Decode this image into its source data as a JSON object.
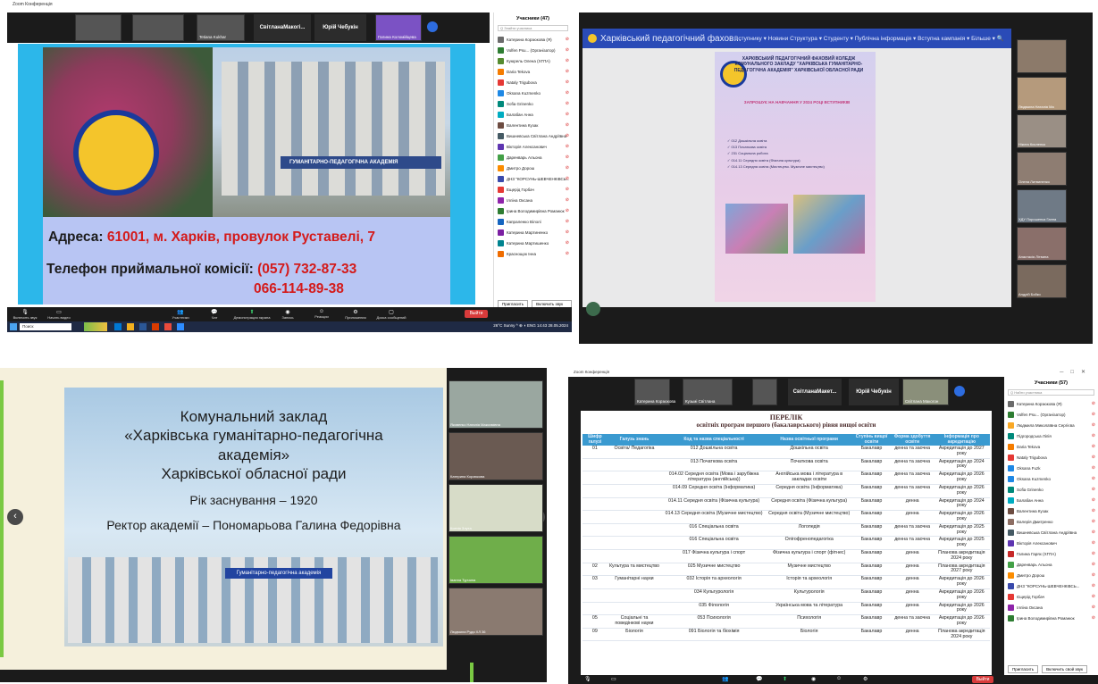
{
  "q1": {
    "app_title": "Zoom Конференція",
    "thumbnails": [
      {
        "name": ""
      },
      {
        "name": ""
      },
      {
        "name": "Tetiana Kukhar"
      },
      {
        "name": "Віктор Олександрович"
      }
    ],
    "name_tiles": [
      "СвітланаМакогі...",
      "Юрій Чебукін"
    ],
    "host_name": "Галина Коломійцева",
    "slide": {
      "sign": "ГУМАНІТАРНО-ПЕДАГОГІЧНА АКАДЕМІЯ",
      "address_label": "Адреса: ",
      "address_value": "61001, м. Харків, провулок Руставелі, 7",
      "phone_label": "Телефон приймальної комісії: ",
      "phone_value": "(057) 732-87-33",
      "phone_value2": "066-114-89-38"
    },
    "panel": {
      "title": "Учасники (47)",
      "search_placeholder": "Q Знайти учасника",
      "items": [
        {
          "name": "Катерина Корзюкова (Я)",
          "color": "#6b6b6b"
        },
        {
          "name": "Volfen Psu... (Організатор)",
          "color": "#2e7d32"
        },
        {
          "name": "Куюрель Олена (ХГПА)",
          "color": "#558b2f"
        },
        {
          "name": "Daria Tekova",
          "color": "#f57c00"
        },
        {
          "name": "Nataly Trigubova",
          "color": "#e53935"
        },
        {
          "name": "Oksana Kuzmenko",
          "color": "#1e88e5"
        },
        {
          "name": "Sofia Grinenko",
          "color": "#00897b"
        },
        {
          "name": "Балабан Анна",
          "color": "#00acc1"
        },
        {
          "name": "Валентина Кузак",
          "color": "#6d4c41"
        },
        {
          "name": "Вишневська Світлана Андріївна",
          "color": "#455a64"
        },
        {
          "name": "Вікторія Алексанович",
          "color": "#5e35b1"
        },
        {
          "name": "Даренварь Альона",
          "color": "#43a047"
        },
        {
          "name": "Дмитро Дорош",
          "color": "#fb8c00"
        },
        {
          "name": "ДНЗ \"КОРСУНЬ-ШЕВЧЕНКІВСЬ...",
          "color": "#3949ab"
        },
        {
          "name": "Ещерід Горбач",
          "color": "#e53935"
        },
        {
          "name": "Ілліна Оксана",
          "color": "#8e24aa"
        },
        {
          "name": "Ірина Володимирівна Романюк",
          "color": "#2e7d32"
        },
        {
          "name": "Капраленко Вілолі",
          "color": "#1565c0"
        },
        {
          "name": "Катерина Мартиненко",
          "color": "#7b1fa2"
        },
        {
          "name": "Катерина Мартишенко",
          "color": "#00838f"
        },
        {
          "name": "Краснощок Інна",
          "color": "#ef6c00"
        }
      ],
      "invite_button": "Пригласить",
      "mute_all_button": "Включить звук все"
    },
    "toolbar": {
      "items": [
        "Включить звук",
        "Начать видео",
        "Участники",
        "Чат",
        "Демонстрация экрана",
        "Запись",
        "Реакции",
        "Приложения",
        "Доска сообщений"
      ],
      "end_button": "Выйти"
    },
    "taskbar": {
      "search": "Поиск",
      "tray": "26°C Sunny  ^ ⊕ ◖ ENG 14:43 28.05.2024"
    }
  },
  "q2": {
    "site_title": "Харківський педагогічний фахов...",
    "menu": "Вступнику ▾   Новини   Структура ▾   Студенту ▾   Публічна інформація ▾   Вступна кампанія ▾   Більше ▾   🔍",
    "poster_head": "ХАРКІВСЬКИЙ ПЕДАГОГІЧНИЙ ФАХОВИЙ КОЛЕДЖ КОМУНАЛЬНОГО ЗАКЛАДУ \"ХАРКІВСЬКА ГУМАНІТАРНО-ПЕДАГОГІЧНА АКАДЕМІЯ\" ХАРКІВСЬКОЇ ОБЛАСНОЇ РАДИ",
    "poster_invite": "ЗАПРОШУЄ НА НАВЧАННЯ У 2024 РОЦІ ВСТУПНИКІВ",
    "bullets": [
      "012 Дошкільна освіта",
      "013 Початкова освіта",
      "231 Соціальна робота",
      "014.11 Середня освіта (Фізична культура)",
      "014.13 Середня освіта (Мистецтво. Музичне мистецтво)"
    ],
    "participants": [
      "",
      "Людмила Наталія Ма",
      "Нікита Кисленко",
      "Олена Литвиненко",
      "ХДУ Порошенка Ганна",
      "Анастасія Літвина",
      "Андрій Бойко"
    ]
  },
  "q3": {
    "title_lines": [
      "Комунальний заклад",
      "«Харківська гуманітарно-педагогічна",
      "академія»",
      "Харківської обласної ради"
    ],
    "founded": "Рік заснування – 1920",
    "rector": "Ректор академії – Пономарьова Галина Федорівна",
    "sign": "Гуманітарно-педагогічна академія",
    "arrow_prev": "‹",
    "arrow_next": "›",
    "participants": [
      "Яковенко Наталія Максимівна",
      "Катерина Корзюкова",
      "Ксенія Злута",
      "Іванна Турчина",
      "Людмила Рудя ХЛ 36"
    ]
  },
  "q4": {
    "app_title": "Zoom Конференція",
    "thumbnails": [
      "Катерина Корзюкова",
      "Кузьмі Світлана",
      "Світлана Макогон"
    ],
    "name_tiles": [
      "СвітланаМакет...",
      "Юрій Чебукін"
    ],
    "doc_title": "ПЕРЕЛІК",
    "doc_subtitle": "освітніх програм першого (бакалаврського) рівня  вищої освіти",
    "table": {
      "headers": [
        "Шифр галузі",
        "Галузь знань",
        "Код та назва спеціальності",
        "Назва освітньої програми",
        "Ступінь вищої освіти",
        "Форма здобуття освіти",
        "Інформація про акредитацію"
      ],
      "rows": [
        [
          "01",
          "Освіта/ Педагогіка",
          "012 Дошкільна освіта",
          "Дошкільна освіта",
          "Бакалавр",
          "денна та заочна",
          "Акредитація до 2027 року"
        ],
        [
          "",
          "",
          "013 Початкова освіта",
          "Початкова освіта",
          "Бакалавр",
          "денна та заочна",
          "Акредитація до 2024 року"
        ],
        [
          "",
          "",
          "014.02 Середня освіта (Мова і зарубіжна література (англійська))",
          "Англійська мова і література в закладах освіти",
          "Бакалавр",
          "денна та заочна",
          "Акредитація до 2026 року"
        ],
        [
          "",
          "",
          "014.09 Середня освіта (Інформатика)",
          "Середня освіта (Інформатика)",
          "Бакалавр",
          "денна та заочна",
          "Акредитація до 2026 року"
        ],
        [
          "",
          "",
          "014.11 Середня освіта (Фізична культура)",
          "Середня освіта (Фізична культура)",
          "Бакалавр",
          "денна",
          "Акредитація до 2024 року"
        ],
        [
          "",
          "",
          "014.13 Середня освіта (Музичне мистецтво)",
          "Середня освіта (Музичне мистецтво)",
          "Бакалавр",
          "денна",
          "Акредитація до 2026 року"
        ],
        [
          "",
          "",
          "016 Спеціальна освіта",
          "Логопедія",
          "Бакалавр",
          "денна та заочна",
          "Акредитація до 2025 року"
        ],
        [
          "",
          "",
          "016 Спеціальна освіта",
          "Олігофренопедагогіка",
          "Бакалавр",
          "денна та заочна",
          "Акредитація до 2025 року"
        ],
        [
          "",
          "",
          "017 Фізична культура і спорт",
          "Фізична культура і спорт (фітнес)",
          "Бакалавр",
          "денна",
          "Планова акредитація 2024 року"
        ],
        [
          "02",
          "Культура та мистецтво",
          "025 Музичне мистецтво",
          "Музичне мистецтво",
          "Бакалавр",
          "денна",
          "Планова акредитація 2027 року"
        ],
        [
          "03",
          "Гуманітарні науки",
          "032 Історія та археологія",
          "Історія та археологія",
          "Бакалавр",
          "денна",
          "Акредитація до 2026 року"
        ],
        [
          "",
          "",
          "034 Культурологія",
          "Культурологія",
          "Бакалавр",
          "денна",
          "Акредитація до 2026 року"
        ],
        [
          "",
          "",
          "035 Філологія",
          "Українська мова та література",
          "Бакалавр",
          "денна",
          "Акредитація до 2026 року"
        ],
        [
          "05",
          "Соціальні та поведінкові науки",
          "053 Психологія",
          "Психологія",
          "Бакалавр",
          "денна та заочна",
          "Акредитація до 2026 року"
        ],
        [
          "09",
          "Біологія",
          "091 Біологія та біохімія",
          "Біологія",
          "Бакалавр",
          "денна",
          "Планова акредитація 2024 року"
        ]
      ]
    },
    "panel": {
      "title": "Учасники (57)",
      "search_placeholder": "Q Найти участника",
      "items": [
        {
          "name": "Катерина Корзюкова (Я)",
          "color": "#6b6b6b"
        },
        {
          "name": "Volfen Psu... (Організатор)",
          "color": "#2e7d32"
        },
        {
          "name": "Людмила Миколаївна Сергієва",
          "color": "#f9a825"
        },
        {
          "name": "Підгородська Лілія",
          "color": "#00897b"
        },
        {
          "name": "Daria Tekova",
          "color": "#f57c00"
        },
        {
          "name": "Nataly Trigubova",
          "color": "#e53935"
        },
        {
          "name": "Oksana Fuzk",
          "color": "#1e88e5"
        },
        {
          "name": "Oksana Kuzmenko",
          "color": "#1e88e5"
        },
        {
          "name": "Sofia Grinenko",
          "color": "#00897b"
        },
        {
          "name": "Балабан Анна",
          "color": "#00acc1"
        },
        {
          "name": "Валентина Кузак",
          "color": "#6d4c41"
        },
        {
          "name": "Валерія Дмитренко",
          "color": "#8d6e63"
        },
        {
          "name": "Вишневська Світлана Андріївна",
          "color": "#455a64"
        },
        {
          "name": "Вікторія Алексанович",
          "color": "#5e35b1"
        },
        {
          "name": "Галина Гарях (ХГПА)",
          "color": "#c62828"
        },
        {
          "name": "Даренварь Альона",
          "color": "#43a047"
        },
        {
          "name": "Дмитро Дорош",
          "color": "#fb8c00"
        },
        {
          "name": "ДНЗ \"КОРСУНЬ-ШЕВЧЕНКІВСЬ...",
          "color": "#3949ab"
        },
        {
          "name": "Єщерід Горбач",
          "color": "#e53935"
        },
        {
          "name": "Ілліна Оксана",
          "color": "#8e24aa"
        },
        {
          "name": "Ірина Володимирівна Романюк",
          "color": "#2e7d32"
        }
      ],
      "invite_button": "Пригласить",
      "mute_all_button": "Включить свой звук"
    },
    "end_button": "Выйти"
  }
}
